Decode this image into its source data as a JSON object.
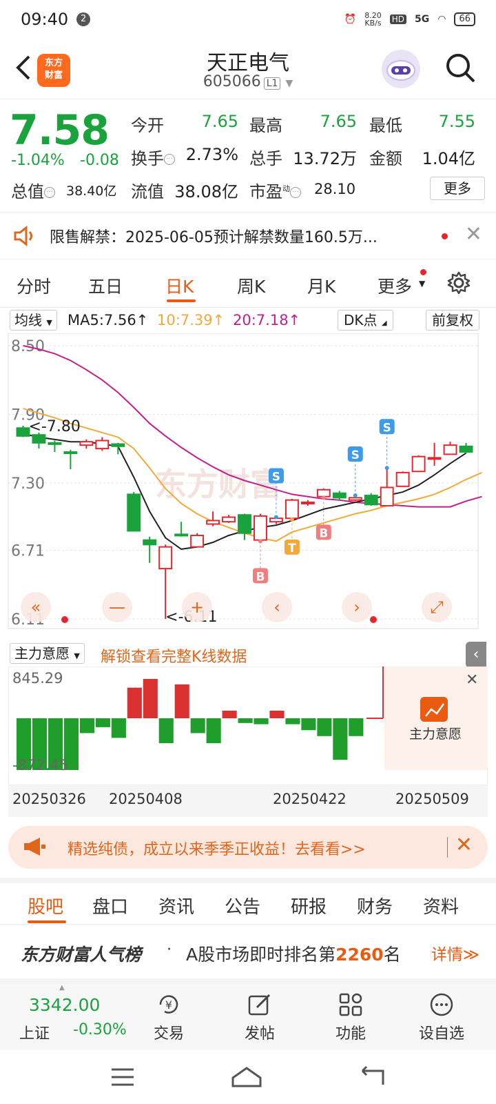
{
  "status": {
    "time": "09:40",
    "notif_count": "2",
    "net_speed": "8.20\nKB/s",
    "hd": "HD",
    "signal": "5G",
    "battery": "66"
  },
  "header": {
    "title": "天正电气",
    "code": "605066",
    "level": "L1"
  },
  "quote": {
    "price": "7.58",
    "pct_change": "-1.04%",
    "change": "-0.08",
    "open_label": "今开",
    "open": "7.65",
    "high_label": "最高",
    "high": "7.65",
    "low_label": "最低",
    "low": "7.55",
    "turnover_label": "换手",
    "turnover": "2.73%",
    "volume_label": "总手",
    "volume": "13.72万",
    "amount_label": "金额",
    "amount": "1.04亿",
    "mktcap_label": "总值",
    "mktcap": "38.40亿",
    "float_label": "流值",
    "float_cap": "38.08亿",
    "pe_label": "市盈",
    "pe_sup": "动",
    "pe": "28.10",
    "more_label": "更多"
  },
  "notice": {
    "text": "限售解禁：2025-06-05预计解禁数量160.5万..."
  },
  "chart_tabs": [
    "分时",
    "五日",
    "日K",
    "周K",
    "月K",
    "更多"
  ],
  "chart_header": {
    "ma_select": "均线",
    "ma5": "MA5:7.56↑",
    "ma10": "10:7.39↑",
    "ma20": "20:7.18↑",
    "dk": "DK点",
    "adjust": "前复权"
  },
  "colors": {
    "up": "#e6262f",
    "down": "#1aa33d",
    "ma5": "#222222",
    "ma10": "#f2a93b",
    "ma20": "#c21f8a",
    "accent": "#ea5b12"
  },
  "chart_data": {
    "type": "candlestick",
    "y_ticks": [
      "8.50",
      "7.90",
      "7.30",
      "6.71",
      "6.11"
    ],
    "ylim": [
      6.11,
      8.5
    ],
    "high_marker": "<-7.80",
    "low_marker": "<-6.11",
    "x_ticks": [
      "20250326",
      "20250408",
      "20250422",
      "20250509"
    ],
    "candles": [
      {
        "o": 7.78,
        "c": 7.71,
        "h": 7.8,
        "l": 7.7
      },
      {
        "o": 7.72,
        "c": 7.65,
        "h": 7.74,
        "l": 7.6
      },
      {
        "o": 7.65,
        "c": 7.64,
        "h": 7.67,
        "l": 7.57
      },
      {
        "o": 7.57,
        "c": 7.56,
        "h": 7.59,
        "l": 7.42
      },
      {
        "o": 7.63,
        "c": 7.66,
        "h": 7.68,
        "l": 7.6
      },
      {
        "o": 7.6,
        "c": 7.67,
        "h": 7.7,
        "l": 7.58
      },
      {
        "o": 7.64,
        "c": 7.62,
        "h": 7.65,
        "l": 7.55
      },
      {
        "o": 7.2,
        "c": 6.88,
        "h": 7.22,
        "l": 6.88
      },
      {
        "o": 6.8,
        "c": 6.76,
        "h": 6.83,
        "l": 6.6
      },
      {
        "o": 6.55,
        "c": 6.74,
        "h": 6.76,
        "l": 6.11
      },
      {
        "o": 6.85,
        "c": 6.84,
        "h": 6.96,
        "l": 6.83
      },
      {
        "o": 6.74,
        "c": 6.84,
        "h": 6.86,
        "l": 6.74
      },
      {
        "o": 6.94,
        "c": 6.97,
        "h": 7.05,
        "l": 6.92
      },
      {
        "o": 6.96,
        "c": 7.0,
        "h": 7.02,
        "l": 6.95
      },
      {
        "o": 7.02,
        "c": 6.86,
        "h": 7.03,
        "l": 6.8
      },
      {
        "o": 6.8,
        "c": 7.01,
        "h": 7.03,
        "l": 6.79
      },
      {
        "o": 6.96,
        "c": 6.99,
        "h": 7.0,
        "l": 6.94
      },
      {
        "o": 6.99,
        "c": 7.15,
        "h": 7.16,
        "l": 6.98
      },
      {
        "o": 7.12,
        "c": 7.13,
        "h": 7.15,
        "l": 7.1
      },
      {
        "o": 7.18,
        "c": 7.24,
        "h": 7.25,
        "l": 7.17
      },
      {
        "o": 7.21,
        "c": 7.17,
        "h": 7.23,
        "l": 7.15
      },
      {
        "o": 7.15,
        "c": 7.17,
        "h": 7.19,
        "l": 7.14
      },
      {
        "o": 7.19,
        "c": 7.11,
        "h": 7.21,
        "l": 7.1
      },
      {
        "o": 7.1,
        "c": 7.26,
        "h": 7.43,
        "l": 7.1
      },
      {
        "o": 7.27,
        "c": 7.39,
        "h": 7.4,
        "l": 7.27
      },
      {
        "o": 7.4,
        "c": 7.53,
        "h": 7.54,
        "l": 7.4
      },
      {
        "o": 7.51,
        "c": 7.52,
        "h": 7.65,
        "l": 7.45
      },
      {
        "o": 7.55,
        "c": 7.63,
        "h": 7.66,
        "l": 7.55
      },
      {
        "o": 7.62,
        "c": 7.57,
        "h": 7.65,
        "l": 7.56
      }
    ],
    "ma5": [
      7.73,
      7.7,
      7.68,
      7.66,
      7.66,
      7.64,
      7.62,
      7.35,
      7.05,
      6.82,
      6.72,
      6.74,
      6.78,
      6.84,
      6.88,
      6.91,
      6.93,
      6.97,
      7.02,
      7.07,
      7.1,
      7.13,
      7.16,
      7.19,
      7.22,
      7.28,
      7.37,
      7.47,
      7.56
    ],
    "ma10": [
      7.95,
      7.91,
      7.87,
      7.82,
      7.78,
      7.74,
      7.7,
      7.6,
      7.43,
      7.25,
      7.12,
      7.03,
      6.96,
      6.91,
      6.86,
      6.82,
      6.79,
      6.87,
      6.91,
      6.95,
      6.99,
      7.03,
      7.06,
      7.1,
      7.13,
      7.16,
      7.2,
      7.26,
      7.33,
      7.39
    ],
    "ma20": [
      8.5,
      8.47,
      8.43,
      8.37,
      8.29,
      8.2,
      8.09,
      7.96,
      7.82,
      7.71,
      7.61,
      7.52,
      7.44,
      7.37,
      7.32,
      7.28,
      7.24,
      7.2,
      7.18,
      7.16,
      7.15,
      7.13,
      7.12,
      7.11,
      7.1,
      7.09,
      7.09,
      7.09,
      7.14,
      7.18
    ],
    "signals": [
      {
        "label": "S",
        "index": 16,
        "type": "sell"
      },
      {
        "label": "S",
        "index": 21,
        "type": "sell"
      },
      {
        "label": "S",
        "index": 23,
        "type": "sell"
      },
      {
        "label": "B",
        "index": 15,
        "type": "buy"
      },
      {
        "label": "B",
        "index": 19,
        "type": "buy"
      },
      {
        "label": "T",
        "index": 17,
        "type": "t"
      }
    ]
  },
  "indicator": {
    "select": "主力意愿",
    "unlock_text": "解锁查看完整K线数据",
    "max_label": "845.29",
    "min_label": "-872.45",
    "lock_label": "主力意愿",
    "bars": [
      -872,
      -872,
      -872,
      -872,
      -250,
      -150,
      -330,
      560,
      720,
      -420,
      620,
      -250,
      -420,
      140,
      -80,
      -100,
      140,
      -100,
      -200,
      -300,
      -700,
      -300,
      0,
      0,
      0,
      0,
      0,
      0,
      0
    ]
  },
  "ad": {
    "text": "精选纯债，成立以来季季正收益！去看看>>"
  },
  "bottom_tabs": [
    "股吧",
    "盘口",
    "资讯",
    "公告",
    "研报",
    "财务",
    "资料"
  ],
  "rank": {
    "title": "东方财富人气榜",
    "dot": "·",
    "prefix": "A股市场即时排名第",
    "rank": "2260",
    "suffix": "名",
    "detail": "详情≫"
  },
  "toolbar": {
    "index_value": "3342.00",
    "index_name": "上证",
    "index_change": "-0.30%",
    "items": [
      "交易",
      "发帖",
      "功能",
      "设自选"
    ]
  }
}
